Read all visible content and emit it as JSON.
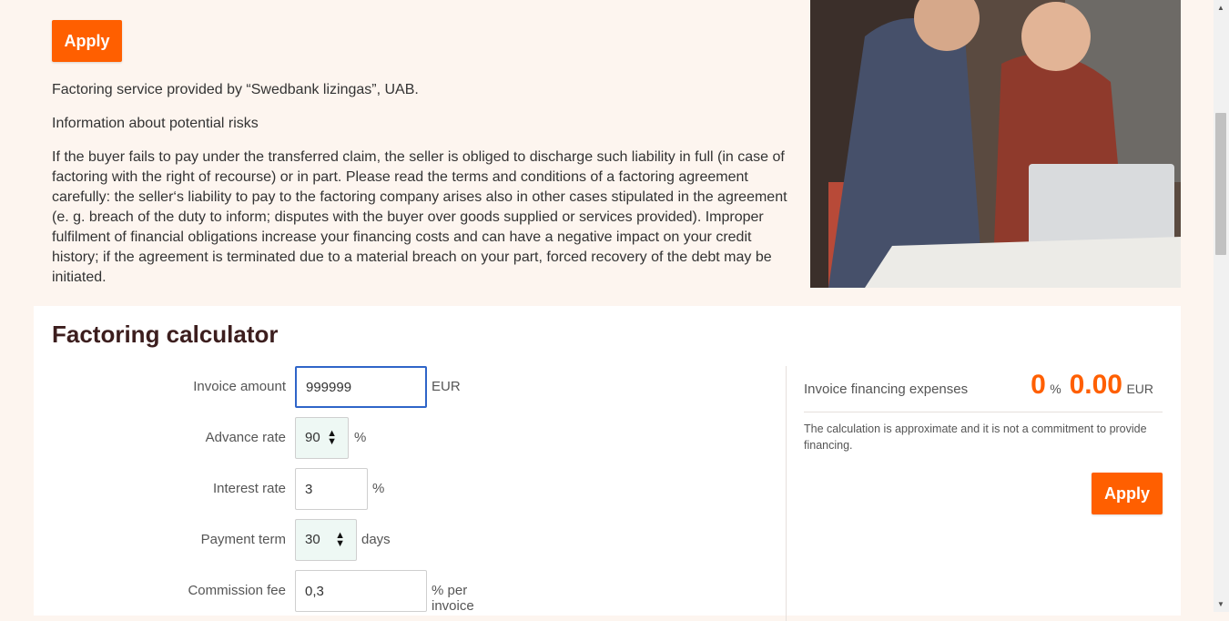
{
  "intro": {
    "apply_label": "Apply",
    "provider": "Factoring service provided by “Swedbank lizingas”, UAB.",
    "risks_heading": "Information about potential risks",
    "risks_text": "If the buyer fails to pay under the transferred claim, the seller is obliged to discharge such liability in full (in case of factoring with the right of recourse) or in part. Please read the terms and conditions of a factoring agreement carefully: the seller‘s liability to pay to the factoring company arises also in other cases stipulated in the agreement (e. g. breach of the duty to inform; disputes with the buyer over goods supplied or services provided). Improper fulfilment of financial obligations increase your financing costs and can have a negative impact on your credit history; if the agreement is terminated due to a material breach on your part, forced recovery of the debt may be initiated."
  },
  "calculator": {
    "title": "Factoring calculator",
    "invoice_amount": {
      "label": "Invoice amount",
      "value": "999999",
      "unit": "EUR"
    },
    "advance_rate": {
      "label": "Advance rate",
      "value": "90",
      "unit": "%"
    },
    "interest_rate": {
      "label": "Interest rate",
      "value": "3",
      "unit": "%"
    },
    "payment_term": {
      "label": "Payment term",
      "value": "30",
      "unit": "days"
    },
    "commission_fee": {
      "label": "Commission fee",
      "value": "0,3",
      "unit": "% per invoice"
    },
    "result": {
      "label": "Invoice financing expenses",
      "percent": "0",
      "percent_unit": "%",
      "amount": "0.00",
      "currency": "EUR",
      "disclaimer": "The calculation is approximate and it is not a commitment to provide financing.",
      "apply_label": "Apply"
    }
  },
  "colors": {
    "accent": "#ff5f00",
    "background": "#fdf5ef",
    "title": "#3c1e1e"
  }
}
